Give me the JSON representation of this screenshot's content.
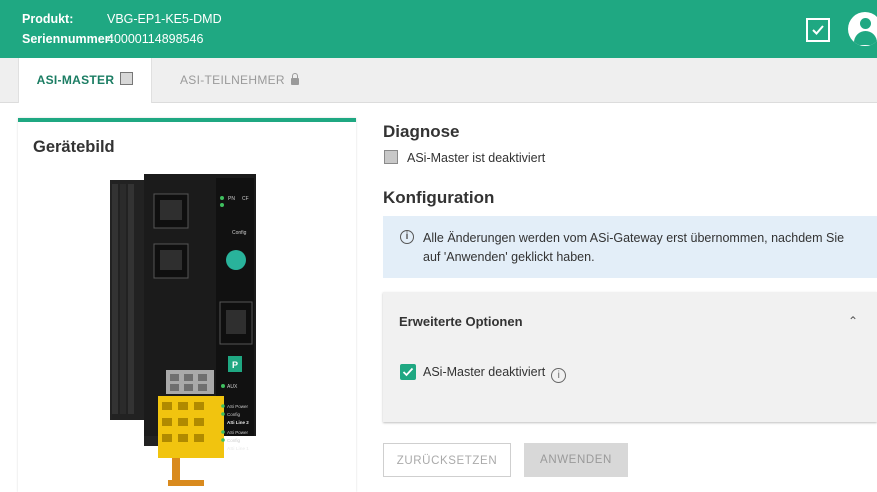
{
  "header": {
    "product_label": "Produkt:",
    "product_value": "VBG-EP1-KE5-DMD",
    "serial_label": "Seriennummer:",
    "serial_value": "40000114898546",
    "status_icon": "check-box-icon",
    "user_icon": "user-icon",
    "color": "#1fa882"
  },
  "tabs": [
    {
      "label": "ASI-MASTER",
      "active": true,
      "icon": "square-indicator-icon"
    },
    {
      "label": "ASI-TEILNEHMER",
      "active": false,
      "icon": "lock-icon"
    }
  ],
  "left_panel": {
    "title": "Gerätebild",
    "device_labels": {
      "pn": "PN",
      "cfg": "CF",
      "config": "Config",
      "aux": "AUX",
      "asi_power": "ASi Power",
      "config2": "Config",
      "asi_line2": "ASi Line 2",
      "asi_power2": "ASi Power",
      "config3": "Config",
      "asi_line1": "ASi Line 1"
    }
  },
  "diagnose": {
    "title": "Diagnose",
    "status_text": "ASi-Master ist deaktiviert"
  },
  "konfiguration": {
    "title": "Konfiguration",
    "info_text": "Alle Änderungen werden vom ASi-Gateway erst übernommen, nachdem Sie auf 'Anwenden' geklickt haben."
  },
  "advanced": {
    "title": "Erweiterte Optionen",
    "expanded": true,
    "option_label": "ASi-Master deaktiviert",
    "option_checked": true
  },
  "buttons": {
    "reset": "ZURÜCKSETZEN",
    "apply": "ANWENDEN"
  }
}
